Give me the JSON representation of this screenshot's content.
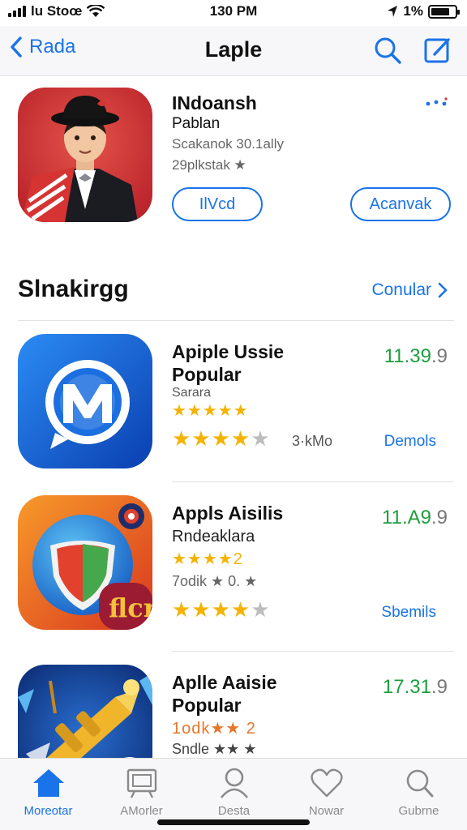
{
  "status": {
    "carrier": "lu Stoœ",
    "time": "130 PM",
    "battery": "1%"
  },
  "nav": {
    "back_label": "Rada",
    "title": "Laple"
  },
  "featured": {
    "name": "INdoansh",
    "developer": "Pablan",
    "meta": "Scakanok 30.1ally",
    "rating": "29plkstak ★",
    "button_left": "IlVcd",
    "button_right": "Acanvak"
  },
  "section": {
    "title": "Slnakirgg",
    "link": "Conular"
  },
  "apps": [
    {
      "name": "Apiple Ussie",
      "name2": "Popular",
      "subtitle": "Sarara",
      "small_stars": "★★★★★",
      "small_stars_value": 5,
      "rating_value": 4.5,
      "count": "3·kMo",
      "price": "11.39",
      "price_dec": ".9",
      "action": "Demols"
    },
    {
      "name": "Appls Aisilis",
      "name2": "Rndeaklara",
      "subtitle": "",
      "small_stars": "★★★★2",
      "small_stars_value": 4,
      "extra": "7odik ★ 0. ★",
      "rating_value": 4,
      "count": "",
      "price": "11.A9",
      "price_dec": ".9",
      "action": "Sbemils"
    },
    {
      "name": "Aplle Aaisie",
      "name2": "Popular",
      "subtitle": "",
      "small_stars": "1odk★★ 2",
      "small_stars_value": 3,
      "extra": "Sndle ★★ ★",
      "rating_value": 0,
      "count": "",
      "price": "17.31",
      "price_dec": ".9",
      "action": ""
    }
  ],
  "tabs": [
    {
      "label": "Moreotar",
      "icon": "home-icon",
      "active": true
    },
    {
      "label": "AMorler",
      "icon": "frame-icon",
      "active": false
    },
    {
      "label": "Desta",
      "icon": "person-icon",
      "active": false
    },
    {
      "label": "Nowar",
      "icon": "heart-icon",
      "active": false
    },
    {
      "label": "Gubrne",
      "icon": "search-icon",
      "active": false
    }
  ],
  "colors": {
    "accent": "#1a73e8",
    "price_green": "#1e9e3e",
    "star": "#f5b301"
  }
}
